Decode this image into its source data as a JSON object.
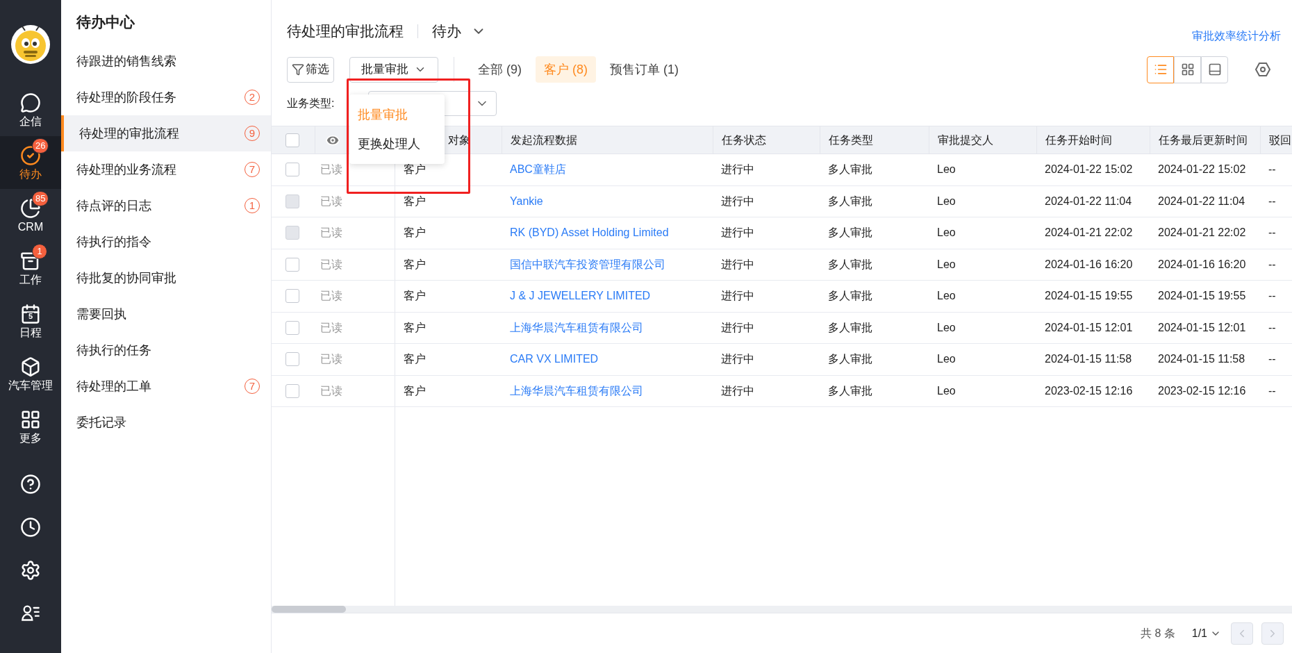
{
  "rail": {
    "items": [
      {
        "kind": "chat",
        "label": "企信",
        "selected": false
      },
      {
        "kind": "check",
        "label": "待办",
        "selected": true,
        "badge": "26"
      },
      {
        "kind": "pie",
        "label": "CRM",
        "selected": false,
        "badge": "85"
      },
      {
        "kind": "box",
        "label": "工作",
        "selected": false,
        "badge": "1"
      },
      {
        "kind": "calendar",
        "label": "日程",
        "selected": false,
        "day": "5"
      },
      {
        "kind": "cube",
        "label": "汽车管理",
        "selected": false
      },
      {
        "kind": "grid",
        "label": "更多",
        "selected": false
      }
    ],
    "tools": [
      {
        "kind": "help"
      },
      {
        "kind": "clock"
      },
      {
        "kind": "settings"
      },
      {
        "kind": "contacts"
      }
    ]
  },
  "sidebar": {
    "title": "待办中心",
    "items": [
      {
        "label": "待跟进的销售线索",
        "selected": false
      },
      {
        "label": "待处理的阶段任务",
        "selected": false,
        "badge": "2"
      },
      {
        "label": "待处理的审批流程",
        "selected": true,
        "badge": "9"
      },
      {
        "label": "待处理的业务流程",
        "selected": false,
        "badge": "7"
      },
      {
        "label": "待点评的日志",
        "selected": false,
        "badge": "1"
      },
      {
        "label": "待执行的指令",
        "selected": false
      },
      {
        "label": "待批复的协同审批",
        "selected": false
      },
      {
        "label": "需要回执",
        "selected": false
      },
      {
        "label": "待执行的任务",
        "selected": false
      },
      {
        "label": "待处理的工单",
        "selected": false,
        "badge": "7"
      },
      {
        "label": "委托记录",
        "selected": false
      }
    ]
  },
  "header": {
    "title": "待处理的审批流程",
    "view": "待办",
    "link": "审批效率统计分析"
  },
  "toolbar": {
    "filter_button": "筛选",
    "batch_button": "批量审批",
    "tabs": [
      {
        "label": "全部 (9)",
        "selected": false
      },
      {
        "label": "客户 (8)",
        "selected": true
      },
      {
        "label": "预售订单 (1)",
        "selected": false
      }
    ],
    "view_modes": [
      {
        "kind": "list",
        "selected": true
      },
      {
        "kind": "grid",
        "selected": false
      },
      {
        "kind": "panel",
        "selected": false
      }
    ]
  },
  "filter": {
    "label": "业务类型:"
  },
  "menu": {
    "items": [
      {
        "label": "批量审批",
        "selected": true
      },
      {
        "label": "更换处理人",
        "selected": false
      }
    ]
  },
  "table": {
    "header_checked": false,
    "columns": [
      {
        "kind": "checkbox"
      },
      {
        "kind": "eye"
      },
      {
        "kind": "text",
        "label": "对象"
      },
      {
        "kind": "text",
        "label": "发起流程数据"
      },
      {
        "kind": "text",
        "label": "任务状态"
      },
      {
        "kind": "text",
        "label": "任务类型"
      },
      {
        "kind": "text",
        "label": "审批提交人"
      },
      {
        "kind": "text",
        "label": "任务开始时间"
      },
      {
        "kind": "text",
        "label": "任务最后更新时间"
      },
      {
        "kind": "text",
        "label": "驳回"
      }
    ],
    "rows": [
      {
        "disabled": false,
        "read": "已读",
        "object": "客户",
        "data": "ABC童鞋店",
        "status": "进行中",
        "type": "多人审批",
        "submitter": "Leo",
        "start": "2024-01-22 15:02",
        "updated": "2024-01-22 15:02",
        "column_10": "--"
      },
      {
        "disabled": true,
        "read": "已读",
        "object": "客户",
        "data": "Yankie",
        "status": "进行中",
        "type": "多人审批",
        "submitter": "Leo",
        "start": "2024-01-22 11:04",
        "updated": "2024-01-22 11:04",
        "column_10": "--"
      },
      {
        "disabled": true,
        "read": "已读",
        "object": "客户",
        "data": "RK (BYD) Asset Holding Limited",
        "status": "进行中",
        "type": "多人审批",
        "submitter": "Leo",
        "start": "2024-01-21 22:02",
        "updated": "2024-01-21 22:02",
        "column_10": "--"
      },
      {
        "disabled": false,
        "read": "已读",
        "object": "客户",
        "data": "国信中联汽车投资管理有限公司",
        "status": "进行中",
        "type": "多人审批",
        "submitter": "Leo",
        "start": "2024-01-16 16:20",
        "updated": "2024-01-16 16:20",
        "column_10": "--"
      },
      {
        "disabled": false,
        "read": "已读",
        "object": "客户",
        "data": "J & J JEWELLERY LIMITED",
        "status": "进行中",
        "type": "多人审批",
        "submitter": "Leo",
        "start": "2024-01-15 19:55",
        "updated": "2024-01-15 19:55",
        "column_10": "--"
      },
      {
        "disabled": false,
        "read": "已读",
        "object": "客户",
        "data": "上海华晨汽车租赁有限公司",
        "status": "进行中",
        "type": "多人审批",
        "submitter": "Leo",
        "start": "2024-01-15 12:01",
        "updated": "2024-01-15 12:01",
        "column_10": "--"
      },
      {
        "disabled": false,
        "read": "已读",
        "object": "客户",
        "data": "CAR VX LIMITED",
        "status": "进行中",
        "type": "多人审批",
        "submitter": "Leo",
        "start": "2024-01-15 11:58",
        "updated": "2024-01-15 11:58",
        "column_10": "--"
      },
      {
        "disabled": false,
        "read": "已读",
        "object": "客户",
        "data": "上海华晨汽车租赁有限公司",
        "status": "进行中",
        "type": "多人审批",
        "submitter": "Leo",
        "start": "2023-02-15 12:16",
        "updated": "2023-02-15 12:16",
        "column_10": "--"
      }
    ]
  },
  "footer": {
    "total": "共 8 条",
    "page": "1/1"
  }
}
